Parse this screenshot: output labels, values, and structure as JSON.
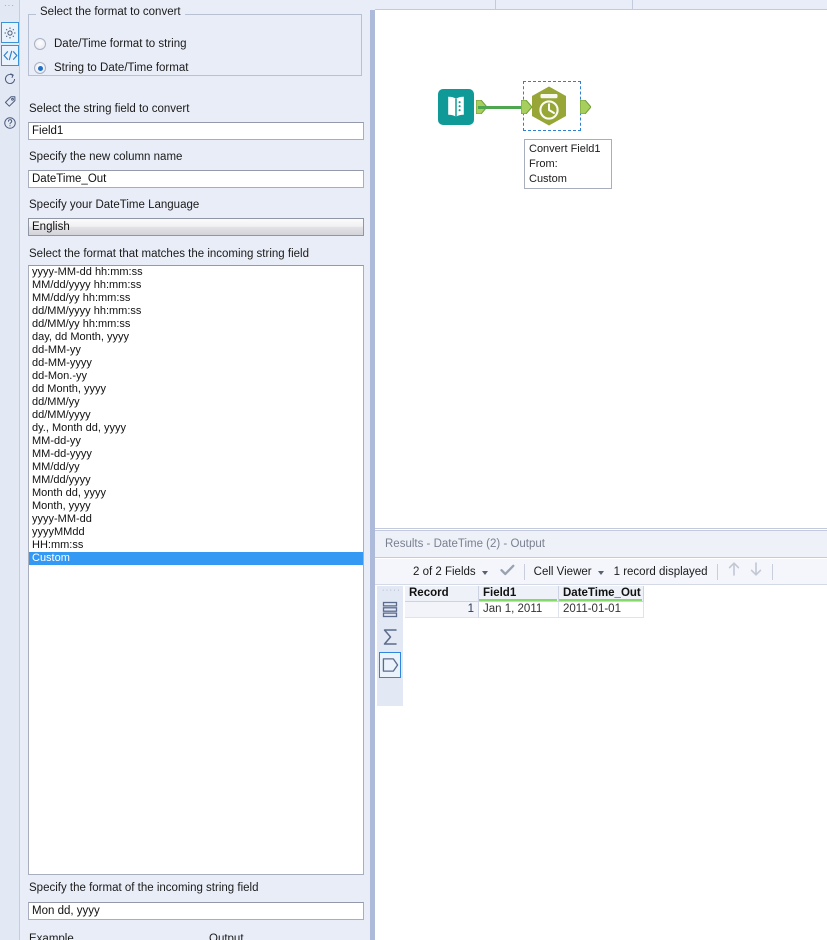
{
  "config_panel": {
    "icon_rail": {
      "dots": "···",
      "items": [
        {
          "name": "gear-icon",
          "label": "Configuration",
          "selected": true
        },
        {
          "name": "code-icon",
          "label": "XML / Code View",
          "selected": true
        },
        {
          "name": "refresh-icon",
          "label": "Runtime",
          "selected": false
        },
        {
          "name": "tag-icon",
          "label": "Annotation",
          "selected": false
        },
        {
          "name": "help-icon",
          "label": "Help",
          "selected": false
        }
      ]
    },
    "groupbox": {
      "legend": "Select the format to convert",
      "options": [
        {
          "label": "Date/Time format to string",
          "checked": false
        },
        {
          "label": "String to Date/Time format",
          "checked": true
        }
      ]
    },
    "string_field": {
      "label": "Select the string field to convert",
      "value": "Field1",
      "placeholder": ""
    },
    "new_column": {
      "label": "Specify the new column name",
      "value": "DateTime_Out",
      "placeholder": ""
    },
    "language": {
      "label": "Specify your DateTime Language",
      "value": "English",
      "options": [
        "English"
      ]
    },
    "format_list": {
      "label": "Select the format that matches the incoming string field",
      "items": [
        "yyyy-MM-dd hh:mm:ss",
        "MM/dd/yyyy hh:mm:ss",
        "MM/dd/yy hh:mm:ss",
        "dd/MM/yyyy hh:mm:ss",
        "dd/MM/yy hh:mm:ss",
        "day, dd Month, yyyy",
        "dd-MM-yy",
        "dd-MM-yyyy",
        "dd-Mon.-yy",
        "dd Month, yyyy",
        "dd/MM/yy",
        "dd/MM/yyyy",
        "dy., Month dd, yyyy",
        "MM-dd-yy",
        "MM-dd-yyyy",
        "MM/dd/yy",
        "MM/dd/yyyy",
        "Month dd, yyyy",
        "Month, yyyy",
        "yyyy-MM-dd",
        "yyyyMMdd",
        "HH:mm:ss",
        "Custom"
      ],
      "selected": "Custom"
    },
    "custom_format": {
      "label": "Specify the format of the incoming string field",
      "value": "Mon dd, yyyy",
      "placeholder": ""
    },
    "bottom_labels": {
      "example": "Example",
      "output": "Output"
    }
  },
  "canvas": {
    "nodes": [
      {
        "name": "text-input-tool",
        "icon": "book-icon",
        "color": "#0f9a97"
      },
      {
        "name": "datetime-tool",
        "icon": "clock-icon",
        "color": "#97a637",
        "selected": true
      }
    ],
    "tooltip": {
      "line1": "Convert Field1",
      "line2": "From:",
      "line3": "Custom"
    }
  },
  "results": {
    "title": "Results - DateTime (2) - Output",
    "toolbar": {
      "fields": "2 of 2 Fields",
      "check_icon": "checkmark-icon",
      "viewer": "Cell Viewer",
      "records": "1 record displayed",
      "up_icon": "arrow-up-icon",
      "down_icon": "arrow-down-icon"
    },
    "rail": {
      "dots": "·····",
      "items": [
        {
          "name": "records-icon",
          "selected": false
        },
        {
          "name": "sigma-icon",
          "selected": false
        },
        {
          "name": "data-profile-icon",
          "selected": true
        }
      ]
    },
    "grid": {
      "columns": [
        {
          "header": "Record",
          "typed": false,
          "width": 74
        },
        {
          "header": "Field1",
          "typed": true,
          "width": 80
        },
        {
          "header": "DateTime_Out",
          "typed": true,
          "width": 85
        }
      ],
      "rows": [
        {
          "record": "1",
          "field1": "Jan 1, 2011",
          "datetime_out": "2011-01-01"
        }
      ]
    }
  },
  "colors": {
    "panel_bg": "#e9edf7",
    "selection_blue": "#3399f3",
    "accent_green": "#4ea64e",
    "type_underline": "#84d96a",
    "tool_teal": "#0f9a97",
    "tool_olive": "#97a637"
  }
}
